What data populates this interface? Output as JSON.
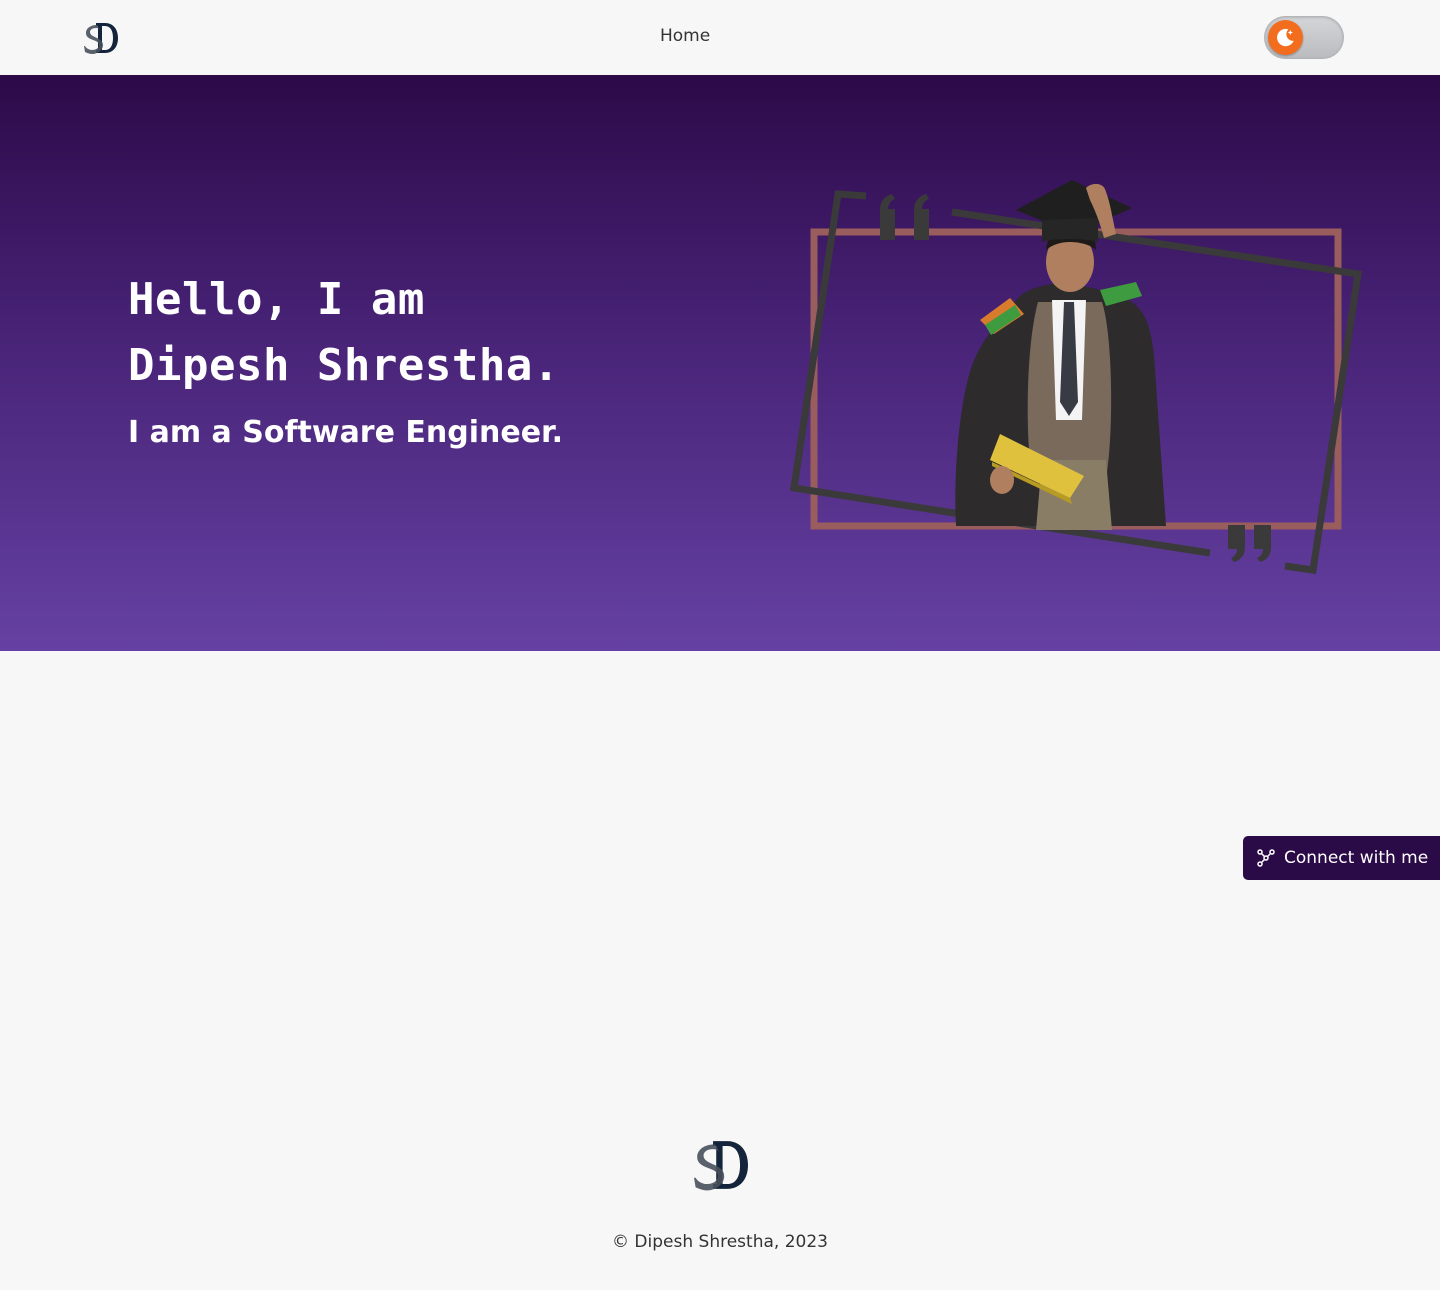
{
  "header": {
    "logo_text": "SD",
    "nav": {
      "home_label": "Home"
    },
    "theme_toggle": {
      "icon": "moon-icon",
      "state": "dark-mode-off",
      "knob_color": "#f36d1e"
    }
  },
  "hero": {
    "greeting_line1": "Hello, I am",
    "greeting_line2": "Dipesh Shrestha.",
    "subtitle": "I am a Software Engineer.",
    "gradient": [
      "#2c0a48",
      "#6541a3"
    ],
    "portrait_alt": "Graduate portrait in cap and gown"
  },
  "connect": {
    "label": "Connect with me",
    "icon": "share-network-icon",
    "color": "#2b0b47"
  },
  "footer": {
    "logo_text": "SD",
    "copyright": "© Dipesh Shrestha, 2023"
  }
}
